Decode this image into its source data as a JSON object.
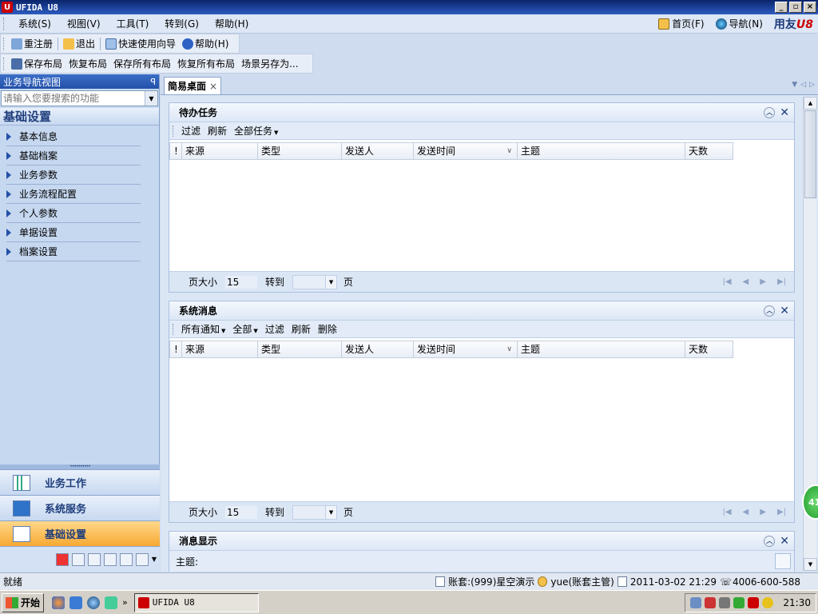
{
  "window": {
    "title": "UFIDA U8",
    "icon": "ufida-logo-icon"
  },
  "menubar": {
    "items": [
      "系统(S)",
      "视图(V)",
      "工具(T)",
      "转到(G)",
      "帮助(H)"
    ],
    "home_label": "首页(F)",
    "nav_label": "导航(N)",
    "brand_text": "用友",
    "brand_suffix": "U8"
  },
  "toolbar1": {
    "buttons": [
      "重注册",
      "退出",
      "快速使用向导",
      "帮助(H)"
    ]
  },
  "toolbar2": {
    "buttons": [
      "保存布局",
      "恢复布局",
      "保存所有布局",
      "恢复所有布局",
      "场景另存为..."
    ]
  },
  "leftnav": {
    "header": "业务导航视图",
    "pin_icon": "pin-icon",
    "search_placeholder": "请输入您要搜索的功能",
    "section_title": "基础设置",
    "items": [
      "基本信息",
      "基础档案",
      "业务参数",
      "业务流程配置",
      "个人参数",
      "单据设置",
      "档案设置"
    ],
    "bottom_tabs": [
      "业务工作",
      "系统服务",
      "基础设置"
    ],
    "active_bottom_tab": "基础设置"
  },
  "docarea": {
    "tab_label": "简易桌面",
    "panels": {
      "todo": {
        "title": "待办任务",
        "toolbar": [
          "过滤",
          "刷新",
          "全部任务"
        ],
        "columns": [
          "!",
          "来源",
          "类型",
          "发送人",
          "发送时间",
          "主题",
          "天数"
        ],
        "page_size_label": "页大小",
        "page_size": "15",
        "goto_label": "转到",
        "page_label": "页"
      },
      "messages": {
        "title": "系统消息",
        "toolbar": [
          "所有通知",
          "全部",
          "过滤",
          "刷新",
          "删除"
        ],
        "columns": [
          "!",
          "来源",
          "类型",
          "发送人",
          "发送时间",
          "主题",
          "天数"
        ],
        "page_size_label": "页大小",
        "page_size": "15",
        "goto_label": "转到",
        "page_label": "页"
      },
      "display": {
        "title": "消息显示",
        "subject_label": "主题:"
      }
    },
    "badge_text": "41"
  },
  "statusbar": {
    "ready": "就绪",
    "account": "账套:(999)星空演示",
    "user": "yue(账套主管)",
    "datetime": "2011-03-02 21:29",
    "phone": "4006-600-588"
  },
  "taskbar": {
    "start_label": "开始",
    "task_label": "UFIDA U8",
    "clock": "21:30"
  },
  "colors": {
    "title_bar": "#0a246a",
    "nav_header": "#2450a8",
    "active_tab": "#f7a932",
    "brand_red": "#cc0000"
  }
}
